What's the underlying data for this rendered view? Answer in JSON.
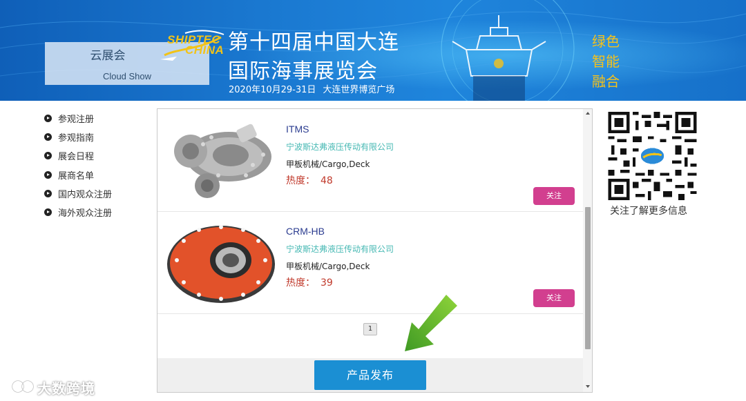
{
  "banner": {
    "cloud_show_cn": "云展会",
    "cloud_show_en": "Cloud Show",
    "logo_line1": "SHIPTEC",
    "logo_line2": "CHINA",
    "title_line1": "第十四届中国大连",
    "title_line2": "国际海事展览会",
    "date": "2020年10月29-31日",
    "venue": "大连世界博览广场",
    "slogan": [
      "绿色",
      "智能",
      "融合"
    ]
  },
  "nav": {
    "items": [
      {
        "label": "参观注册"
      },
      {
        "label": "参观指南"
      },
      {
        "label": "展会日程"
      },
      {
        "label": "展商名单"
      },
      {
        "label": "国内观众注册"
      },
      {
        "label": "海外观众注册"
      }
    ]
  },
  "products": [
    {
      "name": "ITMS",
      "company": "宁波斯达弗液压传动有限公司",
      "category": "甲板机械/Cargo,Deck",
      "heat_label": "热度：",
      "heat_value": "48",
      "follow_label": "关注",
      "image_icon": "hydraulic-motor"
    },
    {
      "name": "CRM-HB",
      "company": "宁波斯达弗液压传动有限公司",
      "category": "甲板机械/Cargo,Deck",
      "heat_label": "热度：",
      "heat_value": "39",
      "follow_label": "关注",
      "image_icon": "hydraulic-motor-red"
    }
  ],
  "pagination": {
    "current_page": "1"
  },
  "publish_button": "产品发布",
  "qr": {
    "caption": "关注了解更多信息"
  },
  "watermark": {
    "text": "大数跨境"
  },
  "colors": {
    "banner_blue": "#1a78d0",
    "slogan_gold": "#f5c21b",
    "follow_pink": "#d23f8f",
    "publish_blue": "#1b8fd3",
    "company_teal": "#45b8b3",
    "heat_red": "#c0392b",
    "arrow_green": "#5db82c"
  }
}
